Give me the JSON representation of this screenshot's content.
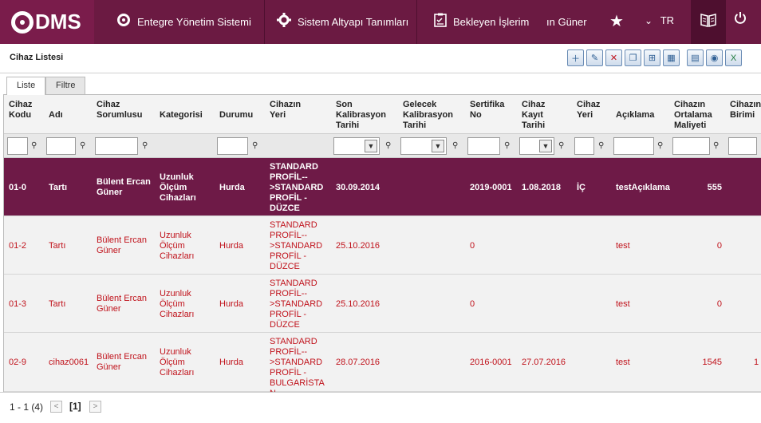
{
  "topbar": {
    "logo": "DMS",
    "menu": [
      {
        "label": "Entegre Yönetim Sistemi",
        "icon": "q-logo-icon"
      },
      {
        "label": "Sistem Altyapı Tanımları",
        "icon": "gear-icon"
      },
      {
        "label": "Bekleyen İşlerim",
        "icon": "clipboard-icon"
      }
    ],
    "user": "ın Güner",
    "language": "TR",
    "colors": {
      "primary": "#6b1a42",
      "dark": "#4e0f2f",
      "selected_row": "#6e1a47",
      "red_text": "#c0121b"
    }
  },
  "panel": {
    "title": "Cihaz Listesi",
    "tabs": [
      "Liste",
      "Filtre"
    ]
  },
  "columns": [
    "Cihaz Kodu",
    "Adı",
    "Cihaz Sorumlusu",
    "Kategorisi",
    "Durumu",
    "Cihazın Yeri",
    "Son Kalibrasyon Tarihi",
    "Gelecek Kalibrasyon Tarihi",
    "Sertifika No",
    "Cihaz Kayıt Tarihi",
    "Cihaz Yeri",
    "Açıklama",
    "Cihazın Ortalama Maliyeti",
    "Cihazın Birimi"
  ],
  "rows": [
    {
      "kod": "01-0",
      "adi": "Tartı",
      "sorumlu": "Bülent Ercan Güner",
      "kategori": "Uzunluk Ölçüm Cihazları",
      "durum": "Hurda",
      "yer": "STANDARD PROFİL-->STANDARD PROFİL - DÜZCE",
      "son_kal": "30.09.2014",
      "gelecek_kal": "",
      "sertifika": "2019-0001",
      "kayit": "1.08.2018",
      "cihaz_yeri": "İÇ",
      "aciklama": "testAçıklama",
      "maliyet": "555",
      "birim": ""
    },
    {
      "kod": "01-2",
      "adi": "Tartı",
      "sorumlu": "Bülent Ercan Güner",
      "kategori": "Uzunluk Ölçüm Cihazları",
      "durum": "Hurda",
      "yer": "STANDARD PROFİL-->STANDARD PROFİL - DÜZCE",
      "son_kal": "25.10.2016",
      "gelecek_kal": "",
      "sertifika": "0",
      "kayit": "",
      "cihaz_yeri": "",
      "aciklama": "test",
      "maliyet": "0",
      "birim": ""
    },
    {
      "kod": "01-3",
      "adi": "Tartı",
      "sorumlu": "Bülent Ercan Güner",
      "kategori": "Uzunluk Ölçüm Cihazları",
      "durum": "Hurda",
      "yer": "STANDARD PROFİL-->STANDARD PROFİL - DÜZCE",
      "son_kal": "25.10.2016",
      "gelecek_kal": "",
      "sertifika": "0",
      "kayit": "",
      "cihaz_yeri": "",
      "aciklama": "test",
      "maliyet": "0",
      "birim": ""
    },
    {
      "kod": "02-9",
      "adi": "cihaz0061",
      "sorumlu": "Bülent Ercan Güner",
      "kategori": "Uzunluk Ölçüm Cihazları",
      "durum": "Hurda",
      "yer": "STANDARD PROFİL-->STANDARD PROFİL - BULGARİSTAN",
      "son_kal": "28.07.2016",
      "gelecek_kal": "",
      "sertifika": "2016-0001",
      "kayit": "27.07.2016",
      "cihaz_yeri": "",
      "aciklama": "test",
      "maliyet": "1545",
      "birim": "1"
    }
  ],
  "pager": {
    "summary": "1 - 1 (4)",
    "current": "[1]",
    "prev": "<",
    "next": ">"
  }
}
